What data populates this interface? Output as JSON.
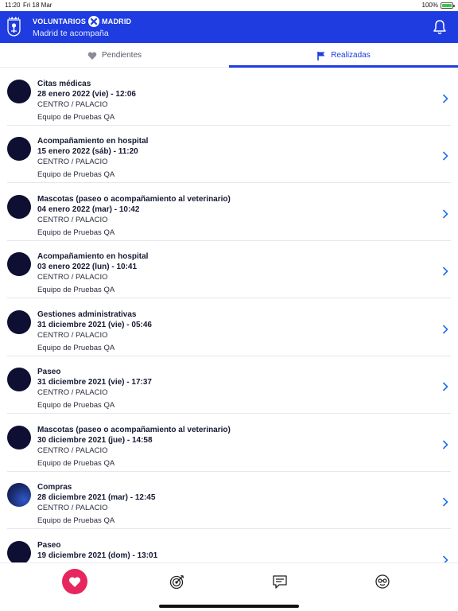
{
  "status_bar": {
    "time": "11:20",
    "date": "Fri 18 Mar",
    "battery": "100%"
  },
  "header": {
    "brand_left": "VOLUNTARIOS",
    "brand_right": "MADRID",
    "subtitle": "Madrid te acompaña",
    "color": "#1e3ce0"
  },
  "tabs": [
    {
      "label": "Pendientes",
      "icon": "heart-icon",
      "selected": false
    },
    {
      "label": "Realizadas",
      "icon": "flag-icon",
      "selected": true
    }
  ],
  "items": [
    {
      "title": "Citas médicas",
      "date": "28 enero 2022 (vie) - 12:06",
      "district": "CENTRO / PALACIO",
      "team": "Equipo de Pruebas QA"
    },
    {
      "title": "Acompañamiento en hospital",
      "date": "15 enero 2022 (sáb) - 11:20",
      "district": "CENTRO / PALACIO",
      "team": "Equipo de Pruebas QA"
    },
    {
      "title": "Mascotas (paseo o acompañamiento al veterinario)",
      "date": "04 enero 2022 (mar) - 10:42",
      "district": "CENTRO / PALACIO",
      "team": "Equipo de Pruebas QA"
    },
    {
      "title": "Acompañamiento en hospital",
      "date": "03 enero 2022 (lun) - 10:41",
      "district": "CENTRO / PALACIO",
      "team": "Equipo de Pruebas QA"
    },
    {
      "title": "Gestiones administrativas",
      "date": "31 diciembre 2021 (vie) - 05:46",
      "district": "CENTRO / PALACIO",
      "team": "Equipo de Pruebas QA"
    },
    {
      "title": "Paseo",
      "date": "31 diciembre 2021 (vie) - 17:37",
      "district": "CENTRO / PALACIO",
      "team": "Equipo de Pruebas QA"
    },
    {
      "title": "Mascotas (paseo o acompañamiento al veterinario)",
      "date": "30 diciembre 2021 (jue) - 14:58",
      "district": "CENTRO / PALACIO",
      "team": "Equipo de Pruebas QA"
    },
    {
      "title": "Compras",
      "date": "28 diciembre 2021 (mar) - 12:45",
      "district": "CENTRO / PALACIO",
      "team": "Equipo de Pruebas QA"
    },
    {
      "title": "Paseo",
      "date": "19 diciembre 2021 (dom) - 13:01",
      "district": "",
      "team": ""
    }
  ],
  "bottom_nav": [
    {
      "icon": "heart-icon",
      "active": true
    },
    {
      "icon": "target-icon",
      "active": false
    },
    {
      "icon": "chat-icon",
      "active": false
    },
    {
      "icon": "profile-icon",
      "active": false
    }
  ]
}
